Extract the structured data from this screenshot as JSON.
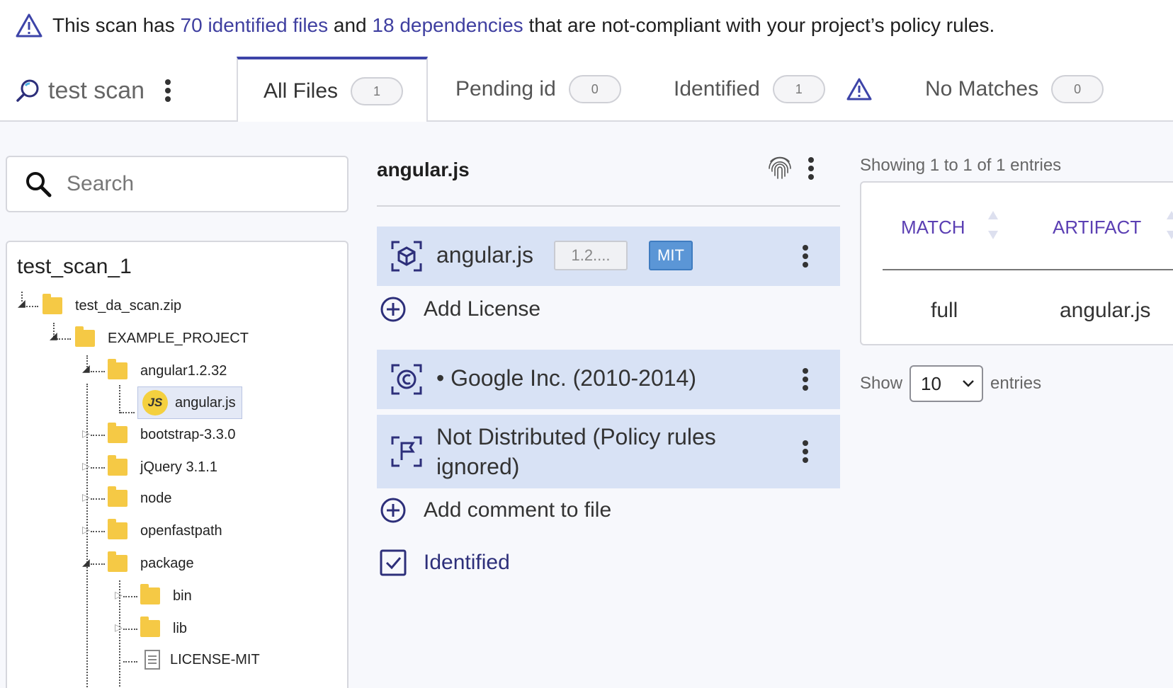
{
  "alert": {
    "prefix": "This scan has ",
    "files_link": "70 identified files",
    "middle": " and ",
    "deps_link": "18 dependencies",
    "suffix": " that are not-compliant with your project’s policy rules."
  },
  "scan": {
    "name": "test scan"
  },
  "tabs": [
    {
      "label": "All Files",
      "count": "1",
      "active": true
    },
    {
      "label": "Pending id",
      "count": "0"
    },
    {
      "label": "Identified",
      "count": "1",
      "warning": true
    },
    {
      "label": "No Matches",
      "count": "0"
    }
  ],
  "search": {
    "placeholder": "Search"
  },
  "tree": {
    "root": "test_scan_1",
    "nodes": [
      {
        "label": "test_da_scan.zip"
      },
      {
        "label": "EXAMPLE_PROJECT"
      },
      {
        "label": "angular1.2.32"
      },
      {
        "label": "angular.js",
        "badge": "JS",
        "selected": true
      },
      {
        "label": "bootstrap-3.3.0"
      },
      {
        "label": "jQuery 3.1.1"
      },
      {
        "label": "node"
      },
      {
        "label": "openfastpath"
      },
      {
        "label": "package"
      },
      {
        "label": "bin"
      },
      {
        "label": "lib"
      },
      {
        "label": "LICENSE-MIT"
      }
    ]
  },
  "detail": {
    "file_name": "angular.js",
    "component": {
      "name": "angular.js",
      "version": "1.2....",
      "license": "MIT"
    },
    "add_license": "Add License",
    "copyright": "• Google Inc. (2010-2014)",
    "distribution_line1": "Not Distributed (Policy rules",
    "distribution_line2": "ignored)",
    "add_comment": "Add comment to file",
    "identified": "Identified"
  },
  "matches": {
    "showing": "Showing 1 to 1 of 1 entries",
    "columns": [
      "MATCH",
      "ARTIFACT"
    ],
    "rows": [
      {
        "match": "full",
        "artifact": "angular.js"
      }
    ],
    "show_label": "Show",
    "page_size": "10",
    "entries_label": "entries"
  },
  "colors": {
    "accent": "#3d44a8",
    "card": "#d8e2f5",
    "license_badge": "#5b96d6",
    "link": "#3f3fa0"
  }
}
